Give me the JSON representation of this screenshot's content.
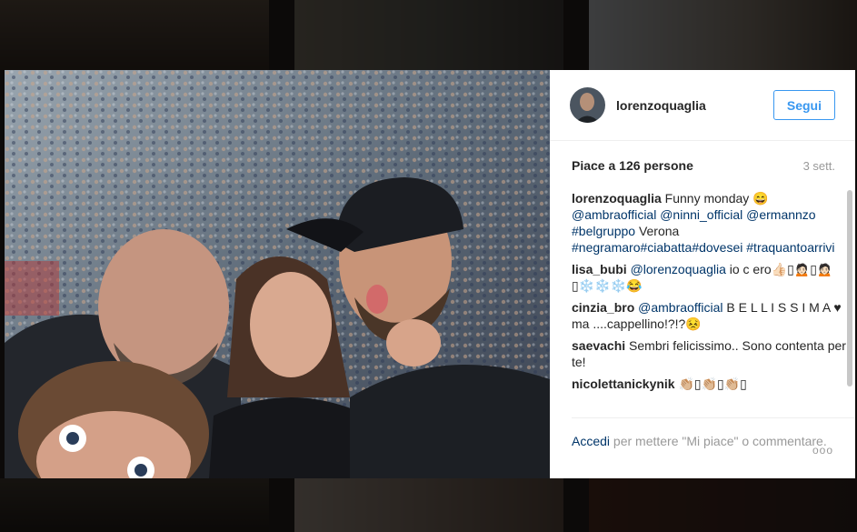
{
  "post": {
    "username": "lorenzoquaglia",
    "follow_label": "Segui",
    "likes_text": "Piace a 126 persone",
    "age": "3 sett."
  },
  "comments": [
    {
      "author": "lorenzoquaglia",
      "parts": [
        {
          "t": "text",
          "v": " Funny monday 😄 "
        },
        {
          "t": "tag",
          "v": "@ambraofficial"
        },
        {
          "t": "text",
          "v": " "
        },
        {
          "t": "tag",
          "v": "@ninni_official"
        },
        {
          "t": "text",
          "v": " "
        },
        {
          "t": "tag",
          "v": "@ermannzo"
        },
        {
          "t": "text",
          "v": " "
        },
        {
          "t": "tag",
          "v": "#belgruppo"
        },
        {
          "t": "text",
          "v": " Verona "
        },
        {
          "t": "tag",
          "v": "#negramaro"
        },
        {
          "t": "tag",
          "v": "#ciabatta"
        },
        {
          "t": "tag",
          "v": "#dovesei"
        },
        {
          "t": "text",
          "v": " "
        },
        {
          "t": "tag",
          "v": "#traquantoarrivi"
        }
      ]
    },
    {
      "author": "lisa_bubi",
      "parts": [
        {
          "t": "text",
          "v": " "
        },
        {
          "t": "tag",
          "v": "@lorenzoquaglia"
        },
        {
          "t": "text",
          "v": " io c ero👍🏻▯🙍🏻▯🙍🏻▯❄️❄️❄️😂"
        }
      ]
    },
    {
      "author": "cinzia_bro",
      "parts": [
        {
          "t": "text",
          "v": " "
        },
        {
          "t": "tag",
          "v": "@ambraofficial"
        },
        {
          "t": "text",
          "v": " B E L L I S S I M A ♥ ma ....cappellino!?!?😣"
        }
      ]
    },
    {
      "author": "saevachi",
      "parts": [
        {
          "t": "text",
          "v": " Sembri felicissimo.. Sono contenta per te!"
        }
      ]
    },
    {
      "author": "nicolettanickynik",
      "parts": [
        {
          "t": "text",
          "v": " 👏🏼▯👏🏼▯👏🏼▯"
        }
      ]
    }
  ],
  "footer": {
    "login_label": "Accedi",
    "rest": " per mettere \"Mi piace\" o commentare.",
    "more": "ooo"
  },
  "icons": [
    "more-options-icon",
    "avatar-icon"
  ],
  "colors": {
    "link": "#003569",
    "accent": "#3897f0",
    "muted": "#999999"
  }
}
